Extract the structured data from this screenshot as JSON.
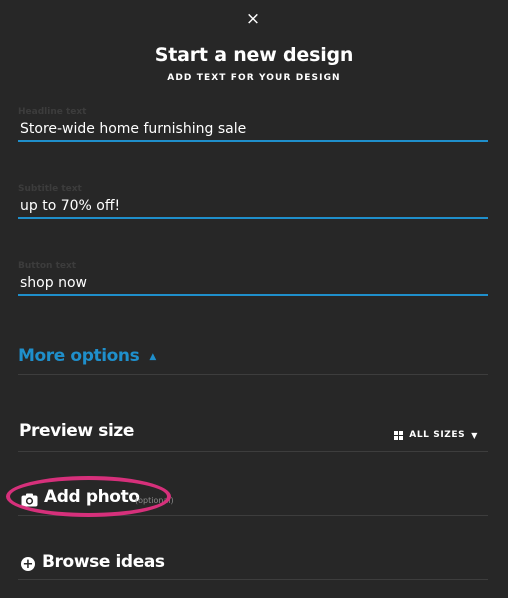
{
  "modal": {
    "close_icon": "×",
    "title": "Start a new design",
    "subtitle": "ADD TEXT FOR YOUR DESIGN"
  },
  "fields": {
    "headline": {
      "label": "Headline text",
      "value": "Store-wide home furnishing sale"
    },
    "subtitle": {
      "label": "Subtitle text",
      "value": "up to 70% off!"
    },
    "button": {
      "label": "Button text",
      "value": "shop now"
    }
  },
  "more_options": {
    "label": "More options",
    "caret": "▲"
  },
  "preview": {
    "title": "Preview size",
    "sizes_label": "ALL SIZES",
    "sizes_caret": "▼"
  },
  "add_photo": {
    "label": "Add photo",
    "optional": "(optional)",
    "icon": "camera-icon"
  },
  "browse": {
    "label": "Browse ideas",
    "icon": "plus-circle-icon",
    "plus": "+"
  },
  "colors": {
    "accent": "#1f8fcb",
    "highlight": "#d6307b",
    "background": "#272727"
  }
}
